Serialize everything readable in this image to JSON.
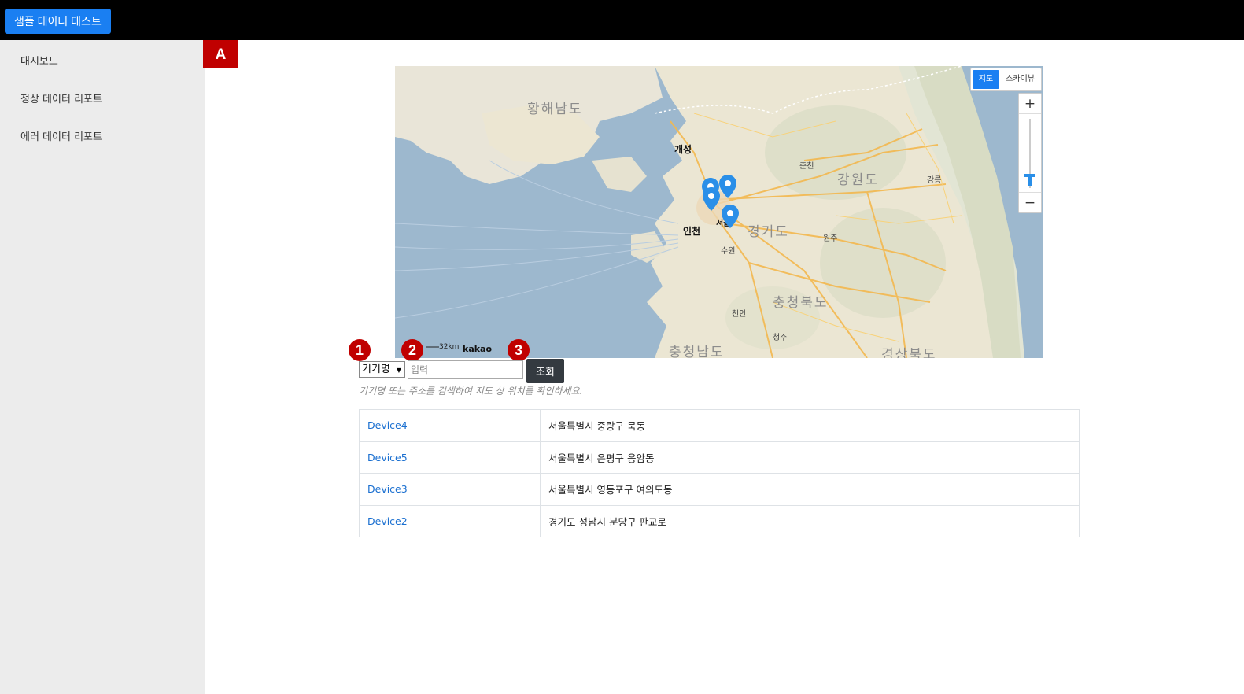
{
  "header": {
    "brand_button": "샘플 데이터 테스트"
  },
  "sidebar": {
    "items": [
      {
        "label": "대시보드"
      },
      {
        "label": "정상 데이터 리포트"
      },
      {
        "label": "에러 데이터 리포트"
      }
    ]
  },
  "annotations": {
    "a": "A",
    "n1": "1",
    "n2": "2",
    "n3": "3"
  },
  "map": {
    "map_type": {
      "map": "지도",
      "skyview": "스카이뷰",
      "selected": "지도"
    },
    "zoom_in": "+",
    "zoom_out": "−",
    "scale": "32km",
    "logo": "kakao",
    "region_labels": [
      "황해남도",
      "강원도",
      "경기도",
      "충청북도",
      "충청남도",
      "경상북도"
    ],
    "city_labels": [
      "개성",
      "인천",
      "서울",
      "수원",
      "춘천",
      "강릉",
      "원주",
      "청주",
      "천안"
    ],
    "marker_count": 4
  },
  "search": {
    "type_selected": "기기명",
    "input_placeholder": "입력",
    "button_label": "조회",
    "hint": "기기명 또는 주소를 검색하여 지도 상 위치를 확인하세요."
  },
  "devices": [
    {
      "name": "Device4",
      "address": "서울특별시 중랑구 묵동"
    },
    {
      "name": "Device5",
      "address": "서울특별시 은평구 응암동"
    },
    {
      "name": "Device3",
      "address": "서울특별시 영등포구 여의도동"
    },
    {
      "name": "Device2",
      "address": "경기도 성남시 분당구 판교로"
    }
  ],
  "colors": {
    "primary": "#1a7ff2",
    "badge": "#c00000",
    "dark_button": "#343a40",
    "link": "#1a6fd0"
  }
}
